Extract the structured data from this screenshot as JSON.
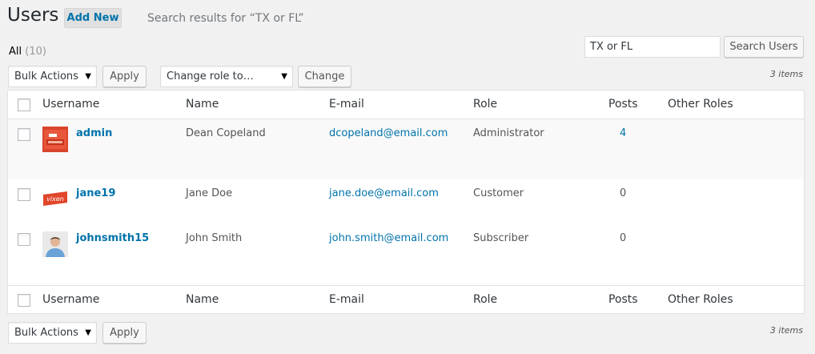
{
  "page": {
    "title": "Users",
    "add_new_label": "Add New",
    "subtitle": "Search results for “TX or FL”"
  },
  "views": {
    "all_label": "All",
    "all_count": "(10)"
  },
  "search": {
    "value": "TX or FL",
    "button_label": "Search Users"
  },
  "toolbar_top": {
    "bulk_label": "Bulk Actions",
    "apply_label": "Apply",
    "role_label": "Change role to…",
    "change_label": "Change",
    "items_count": "3 items"
  },
  "toolbar_bottom": {
    "bulk_label": "Bulk Actions",
    "apply_label": "Apply",
    "items_count": "3 items"
  },
  "columns": {
    "username": "Username",
    "name": "Name",
    "email": "E-mail",
    "role": "Role",
    "posts": "Posts",
    "other_roles": "Other Roles"
  },
  "users": [
    {
      "username": "admin",
      "name": "Dean Copeland",
      "email": "dcopeland@email.com",
      "role": "Administrator",
      "posts": "4",
      "avatar": "red-flyer-avatar"
    },
    {
      "username": "jane19",
      "name": "Jane Doe",
      "email": "jane.doe@email.com",
      "role": "Customer",
      "posts": "0",
      "avatar": "vixen-logo-avatar"
    },
    {
      "username": "johnsmith15",
      "name": "John Smith",
      "email": "john.smith@email.com",
      "role": "Subscriber",
      "posts": "0",
      "avatar": "person-photo-avatar"
    }
  ],
  "colors": {
    "link": "#0073aa",
    "background": "#f1f1f1"
  }
}
